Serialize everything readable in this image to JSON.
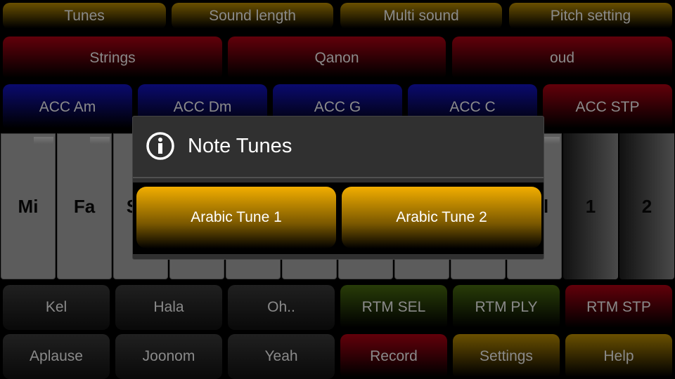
{
  "row1": [
    {
      "label": "Tunes"
    },
    {
      "label": "Sound length"
    },
    {
      "label": "Multi sound"
    },
    {
      "label": "Pitch setting"
    }
  ],
  "row2": [
    {
      "label": "Strings"
    },
    {
      "label": "Qanon"
    },
    {
      "label": "oud"
    }
  ],
  "row3": [
    {
      "label": "ACC Am"
    },
    {
      "label": "ACC Dm"
    },
    {
      "label": "ACC G"
    },
    {
      "label": "ACC C"
    },
    {
      "label": "ACC STP"
    }
  ],
  "keys": [
    "Mi",
    "Fa",
    "Sol",
    "",
    "",
    "",
    "",
    "",
    "",
    "Sol",
    "1",
    "2"
  ],
  "row4": [
    {
      "label": "Kel"
    },
    {
      "label": "Hala"
    },
    {
      "label": "Oh.."
    },
    {
      "label": "RTM SEL"
    },
    {
      "label": "RTM PLY"
    },
    {
      "label": "RTM STP"
    }
  ],
  "row5": [
    {
      "label": "Aplause"
    },
    {
      "label": "Joonom"
    },
    {
      "label": "Yeah"
    },
    {
      "label": "Record"
    },
    {
      "label": "Settings"
    },
    {
      "label": "Help"
    }
  ],
  "dialog": {
    "icon": "info-icon",
    "title": "Note Tunes",
    "options": [
      "Arabic Tune 1",
      "Arabic Tune 2"
    ]
  },
  "colors": {
    "gold": "#6a5000",
    "red": "#62000a",
    "blue": "#0a0a6e",
    "green": "#283c08",
    "dialog_button": "#f2ae00"
  }
}
